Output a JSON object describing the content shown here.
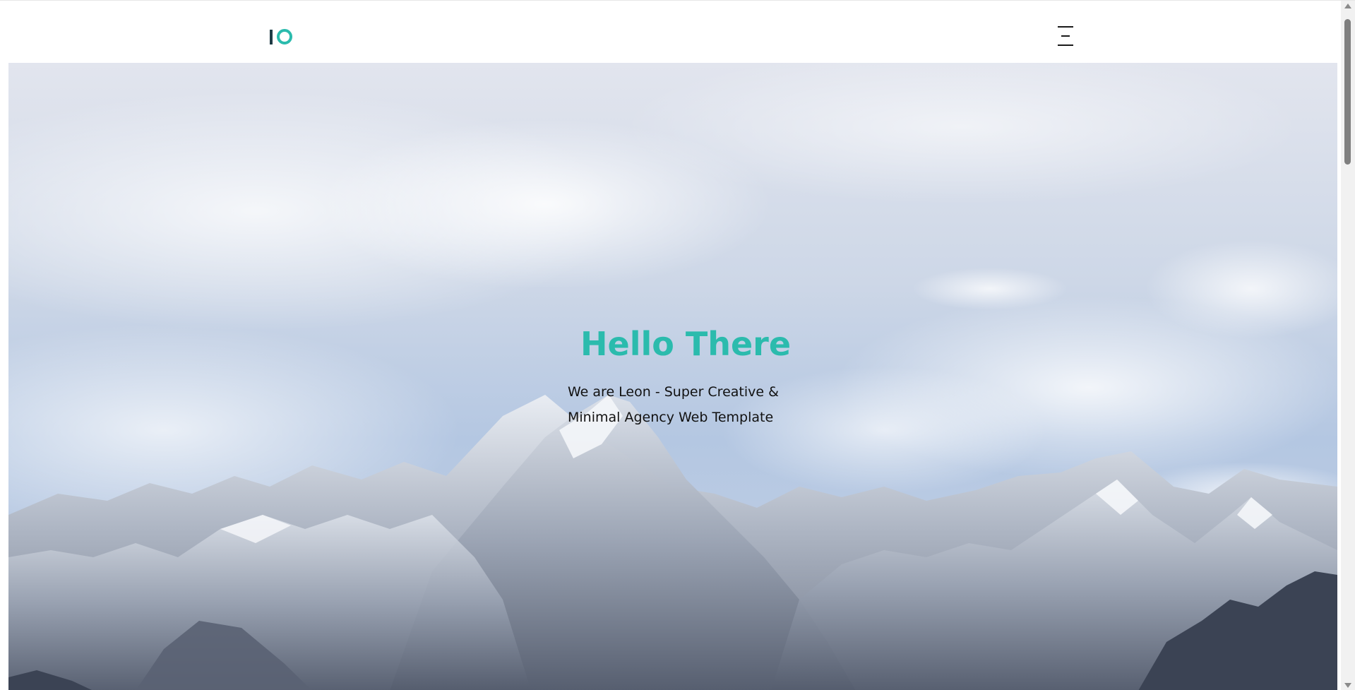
{
  "header": {
    "logo_text": "IO",
    "menu_icon": "hamburger-menu-icon"
  },
  "hero": {
    "title": "Hello There",
    "subtitle": "We are Leon - Super Creative & Minimal Agency Web Template",
    "background": "snowy-mountains-under-cloudy-sky"
  },
  "colors": {
    "accent": "#2bbbad",
    "logo_dark": "#1f3b45",
    "text": "#111111"
  }
}
